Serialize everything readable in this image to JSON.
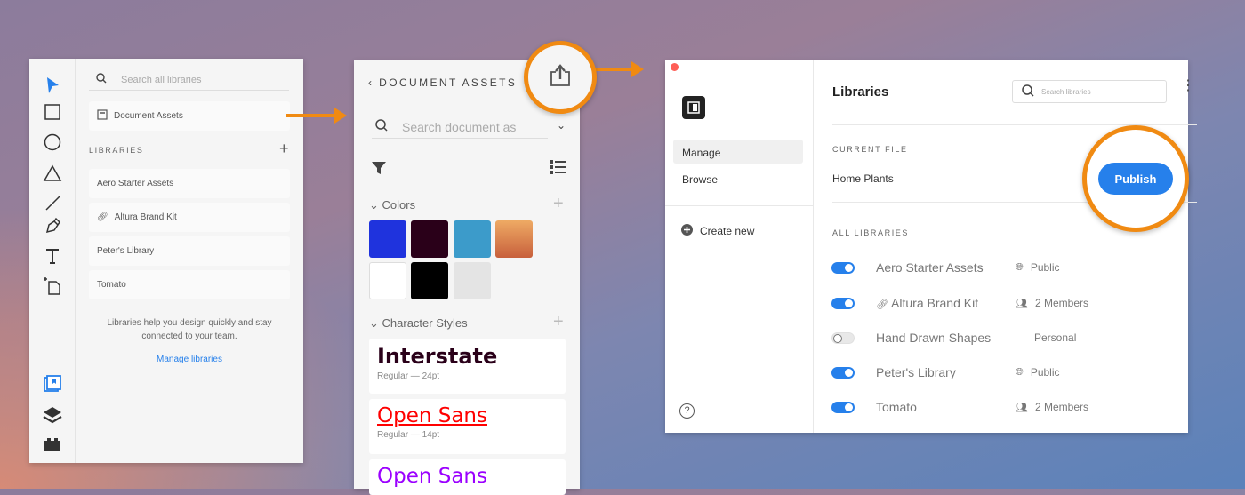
{
  "panel1": {
    "search_placeholder": "Search all libraries",
    "document_assets": "Document Assets",
    "libraries_label": "LIBRARIES",
    "libraries": [
      "Aero Starter Assets",
      "Altura Brand Kit",
      "Peter's Library",
      "Tomato"
    ],
    "help_text": "Libraries help you design quickly and stay connected to your team.",
    "manage_link": "Manage libraries"
  },
  "panel2": {
    "title": "DOCUMENT ASSETS",
    "search_placeholder": "Search document as",
    "colors_label": "Colors",
    "colors": [
      "#1f33dd",
      "#2a0019",
      "#3c9bca",
      "#e8a060",
      "#ffffff",
      "#000000",
      "#e4e4e4"
    ],
    "character_styles_label": "Character Styles",
    "styles": [
      {
        "name": "Interstate",
        "meta": "Regular — 24pt",
        "color": "#2a0019"
      },
      {
        "name": "Open Sans",
        "meta": "Regular — 14pt",
        "color": "#ff0000"
      },
      {
        "name": "Open Sans",
        "meta": "",
        "color": "#9b00ff"
      }
    ]
  },
  "panel3": {
    "nav": [
      "Manage",
      "Browse"
    ],
    "create_new": "Create new",
    "title": "Libraries",
    "search_placeholder": "Search libraries",
    "current_file_label": "CURRENT FILE",
    "current_file": "Home Plants",
    "publish": "Publish",
    "all_libraries_label": "ALL LIBRARIES",
    "libraries": [
      {
        "name": "Aero Starter Assets",
        "visibility": "Public",
        "enabled": true,
        "icon": "globe"
      },
      {
        "name": "Altura Brand Kit",
        "visibility": "2 Members",
        "enabled": true,
        "icon": "members",
        "linked": true
      },
      {
        "name": "Hand Drawn Shapes",
        "visibility": "Personal",
        "enabled": false,
        "icon": ""
      },
      {
        "name": "Peter's Library",
        "visibility": "Public",
        "enabled": true,
        "icon": "globe"
      },
      {
        "name": "Tomato",
        "visibility": "2 Members",
        "enabled": true,
        "icon": "members"
      }
    ]
  },
  "accent": "#2680eb",
  "highlight": "#f08a12"
}
